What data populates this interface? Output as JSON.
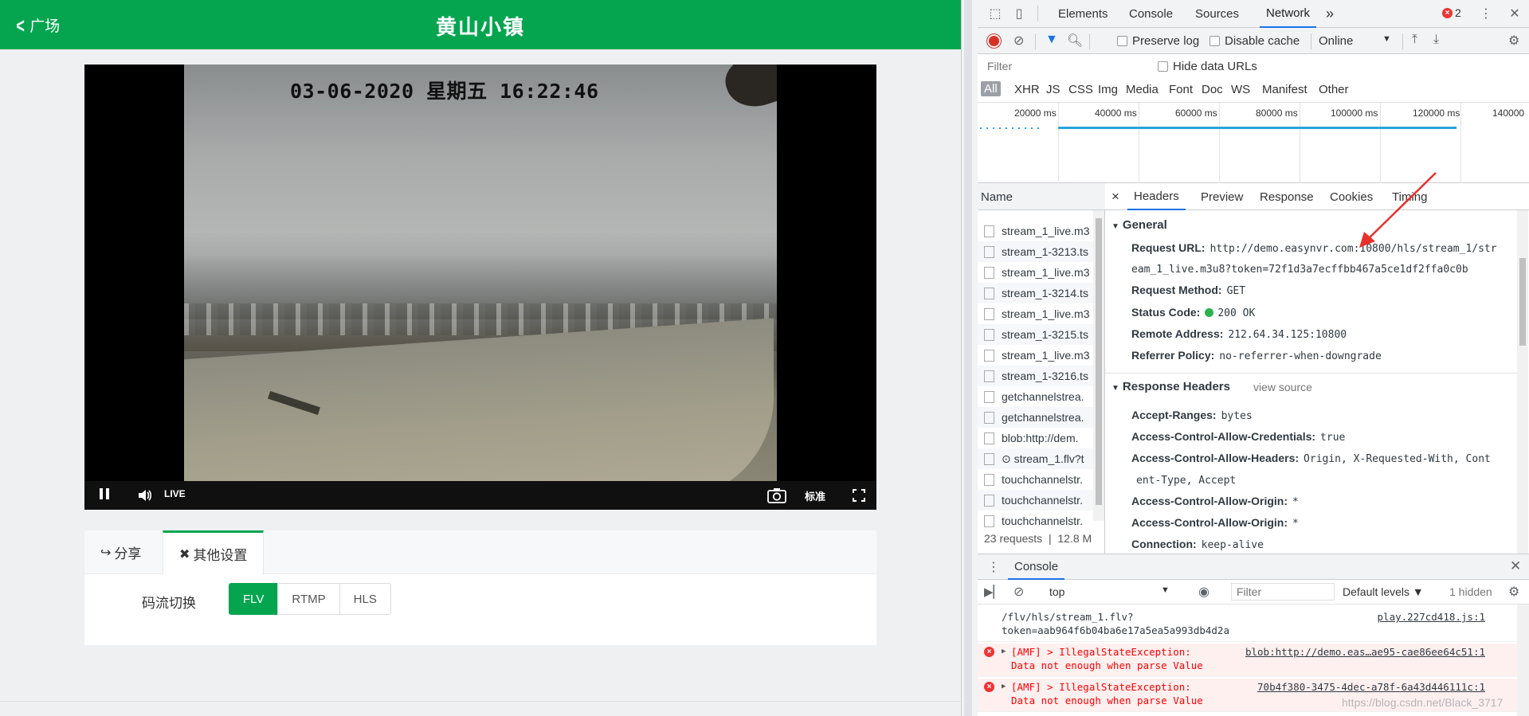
{
  "app": {
    "back_label": "广场",
    "title": "黄山小镇",
    "osd_time": "03-06-2020 星期五 16:22:46",
    "live_label": "LIVE",
    "quality_label": "标准",
    "tabs": [
      {
        "label": "分享"
      },
      {
        "label": "其他设置"
      }
    ],
    "stream_label": "码流切换",
    "stream_options": [
      "FLV",
      "RTMP",
      "HLS"
    ],
    "stream_selected": "FLV"
  },
  "devtools": {
    "tabs": [
      "Elements",
      "Console",
      "Sources",
      "Network"
    ],
    "active_tab": "Network",
    "more_tabs": "»",
    "error_count": "2",
    "toolbar": {
      "preserve_log": "Preserve log",
      "disable_cache": "Disable cache",
      "throttle": "Online"
    },
    "filter_placeholder": "Filter",
    "hide_data_urls": "Hide data URLs",
    "filter_types": [
      "All",
      "XHR",
      "JS",
      "CSS",
      "Img",
      "Media",
      "Font",
      "Doc",
      "WS",
      "Manifest",
      "Other"
    ],
    "timeline_ticks": [
      "20000 ms",
      "40000 ms",
      "60000 ms",
      "80000 ms",
      "100000 ms",
      "120000 ms",
      "140000"
    ],
    "name_header": "Name",
    "requests": [
      "stream_1_live.m3",
      "stream_1-3213.ts",
      "stream_1_live.m3",
      "stream_1-3214.ts",
      "stream_1_live.m3",
      "stream_1-3215.ts",
      "stream_1_live.m3",
      "stream_1-3216.ts",
      "getchannelstrea.",
      "getchannelstrea.",
      "blob:http://dem.",
      "⊙ stream_1.flv?t",
      "touchchannelstr.",
      "touchchannelstr.",
      "touchchannelstr."
    ],
    "summary": {
      "requests": "23 requests",
      "size": "12.8 M"
    },
    "detail_tabs": [
      "Headers",
      "Preview",
      "Response",
      "Cookies",
      "Timing"
    ],
    "close_glyph": "×",
    "general": {
      "title": "General",
      "request_url_key": "Request URL:",
      "request_url_line1": "http://demo.easynvr.com:10800/hls/stream_1/str",
      "request_url_line2": "eam_1_live.m3u8?token=72f1d3a7ecffbb467a5ce1df2ffa0c0b",
      "method_key": "Request Method:",
      "method": "GET",
      "status_key": "Status Code:",
      "status": "200 OK",
      "remote_key": "Remote Address:",
      "remote": "212.64.34.125:10800",
      "referrer_key": "Referrer Policy:",
      "referrer": "no-referrer-when-downgrade"
    },
    "response_headers": {
      "title": "Response Headers",
      "view_source": "view source",
      "items": [
        {
          "k": "Accept-Ranges:",
          "v": "bytes"
        },
        {
          "k": "Access-Control-Allow-Credentials:",
          "v": "true"
        },
        {
          "k": "Access-Control-Allow-Headers:",
          "v": "Origin, X-Requested-With, Cont"
        },
        {
          "k": "",
          "v": "ent-Type, Accept"
        },
        {
          "k": "Access-Control-Allow-Origin:",
          "v": "*"
        },
        {
          "k": "Access-Control-Allow-Origin:",
          "v": "*"
        },
        {
          "k": "Connection:",
          "v": "keep-alive"
        }
      ]
    },
    "console": {
      "tab": "Console",
      "context": "top",
      "filter_placeholder": "Filter",
      "levels": "Default levels ▼",
      "hidden": "1 hidden",
      "messages": [
        {
          "type": "log",
          "text": "/flv/hls/stream_1.flv?\ntoken=aab964f6b04ba6e17a5ea5a993db4d2a",
          "src": "play.227cd418.js:1"
        },
        {
          "type": "error",
          "text": "[AMF] > IllegalStateException:\nData not enough when parse Value",
          "src": "blob:http://demo.eas…ae95-cae86ee64c51:1"
        },
        {
          "type": "error",
          "text": "[AMF] > IllegalStateException:\nData not enough when parse Value",
          "src": "70b4f380-3475-4dec-a78f-6a43d446111c:1"
        }
      ]
    }
  },
  "watermark": "https://blog.csdn.net/Black_3717",
  "colors": {
    "brand": "#05a550",
    "devtools_accent": "#1a73e8",
    "error": "#ff0000"
  }
}
